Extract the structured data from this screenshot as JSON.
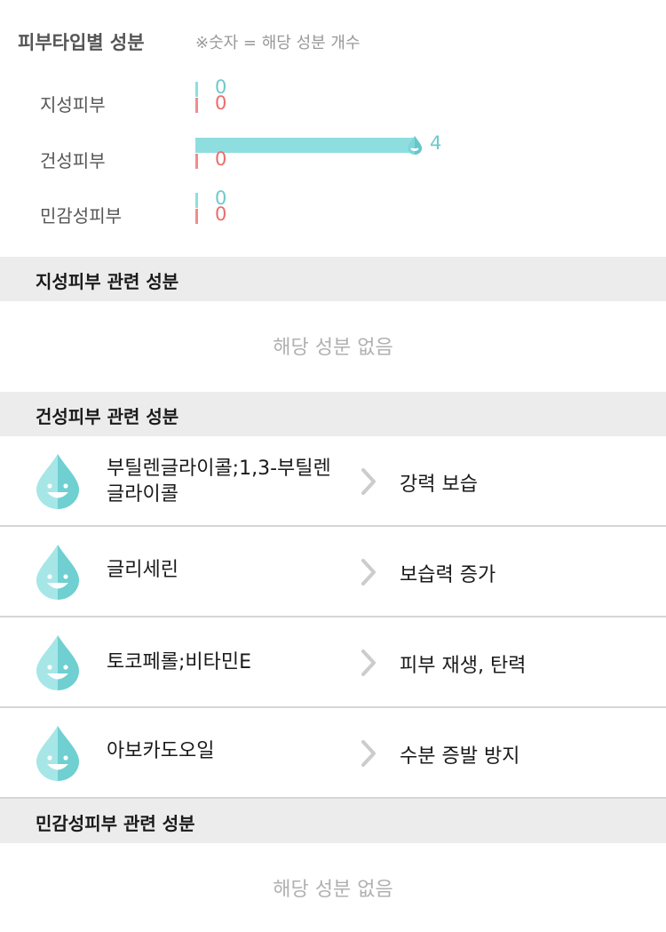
{
  "header": {
    "title": "피부타입별 성분",
    "note": "※숫자 = 해당 성분 개수"
  },
  "skin_types": [
    {
      "label": "지성피부",
      "positive": 0,
      "negative": 0
    },
    {
      "label": "건성피부",
      "positive": 4,
      "negative": 0
    },
    {
      "label": "민감성피부",
      "positive": 0,
      "negative": 0
    }
  ],
  "sections": {
    "oily": {
      "title": "지성피부 관련 성분",
      "empty_text": "해당 성분 없음"
    },
    "dry": {
      "title": "건성피부 관련 성분",
      "items": [
        {
          "name": "부틸렌글라이콜;1,3-부틸렌글라이콜",
          "effect": "강력 보습"
        },
        {
          "name": "글리세린",
          "effect": "보습력 증가"
        },
        {
          "name": "토코페롤;비타민E",
          "effect": "피부 재생, 탄력"
        },
        {
          "name": "아보카도오일",
          "effect": "수분 증발 방지"
        }
      ]
    },
    "sensitive": {
      "title": "민감성피부 관련 성분",
      "empty_text": "해당 성분 없음"
    }
  },
  "colors": {
    "positive_bar": "#8fdedf",
    "negative_bar": "#f08c8c",
    "drop_light": "#a6e6e7",
    "drop_dark": "#6fcfd1"
  },
  "icons": {
    "ingredient": "water-drop-smile-icon",
    "chevron": "chevron-right-icon"
  }
}
